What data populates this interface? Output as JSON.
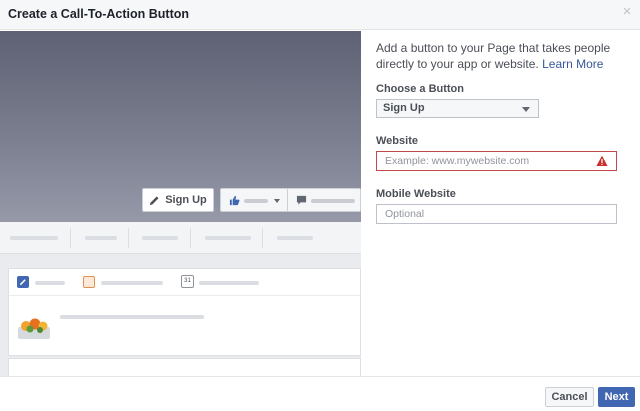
{
  "dialog": {
    "title": "Create a Call-To-Action Button",
    "close_glyph": "×"
  },
  "preview": {
    "cta_label": "Sign Up",
    "calendar_day": "31"
  },
  "form": {
    "intro_text": "Add a button to your Page that takes people directly to your app or website.",
    "learn_more": "Learn More",
    "choose_label": "Choose a Button",
    "choose_value": "Sign Up",
    "website_label": "Website",
    "website_placeholder": "Example: www.mywebsite.com",
    "mobile_label": "Mobile Website",
    "mobile_placeholder": "Optional"
  },
  "footer": {
    "cancel_label": "Cancel",
    "next_label": "Next"
  },
  "colors": {
    "primary": "#4267b2",
    "link": "#365899",
    "error": "#be4b49"
  }
}
